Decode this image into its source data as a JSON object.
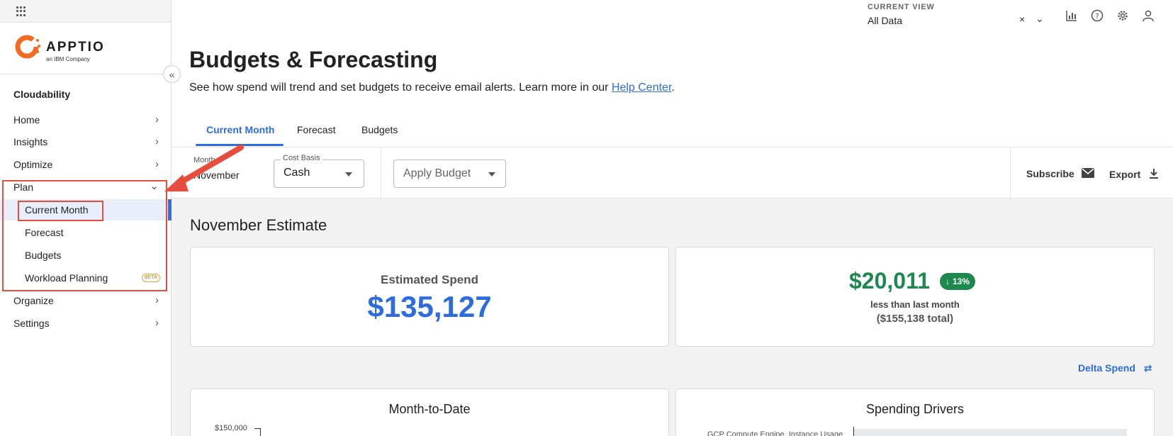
{
  "sidebar": {
    "logo_name": "APPTIO",
    "logo_sub": "an IBM Company",
    "section": "Cloudability",
    "items": [
      {
        "label": "Home"
      },
      {
        "label": "Insights"
      },
      {
        "label": "Optimize"
      },
      {
        "label": "Plan"
      },
      {
        "label": "Organize"
      },
      {
        "label": "Settings"
      }
    ],
    "plan_sub": [
      {
        "label": "Current Month",
        "active": true
      },
      {
        "label": "Forecast"
      },
      {
        "label": "Budgets"
      },
      {
        "label": "Workload Planning",
        "badge": "BETA"
      }
    ]
  },
  "header": {
    "current_view_label": "CURRENT VIEW",
    "current_view_value": "All Data",
    "icons": [
      "bar-chart-icon",
      "help-icon",
      "settings-icon",
      "user-icon"
    ]
  },
  "page": {
    "title": "Budgets & Forecasting",
    "description": "See how spend will trend and set budgets to receive email alerts. Learn more in our ",
    "help_link": "Help Center",
    "description_end": "."
  },
  "tabs": [
    {
      "label": "Current Month",
      "active": true
    },
    {
      "label": "Forecast"
    },
    {
      "label": "Budgets"
    }
  ],
  "controls": {
    "month_label": "Month",
    "month_value": "November",
    "cost_basis_label": "Cost Basis",
    "cost_basis_value": "Cash",
    "apply_budget_placeholder": "Apply Budget",
    "subscribe": "Subscribe",
    "export": "Export"
  },
  "estimate": {
    "section_title": "November Estimate",
    "estimated_label": "Estimated Spend",
    "estimated_value": "$135,127",
    "delta_value": "$20,011",
    "delta_pct": "13%",
    "delta_text": "less than last month",
    "last_total": "($155,138 total)",
    "delta_link": "Delta Spend"
  },
  "charts": {
    "mtd_title": "Month-to-Date",
    "mtd_axis_top": "$150,000",
    "drivers_title": "Spending Drivers",
    "drivers_first": "GCP Compute Engine, Instance Usage"
  },
  "colors": {
    "accent": "#2d6cdf",
    "positive": "#1c8a4e",
    "annotation": "#e74c3c"
  }
}
